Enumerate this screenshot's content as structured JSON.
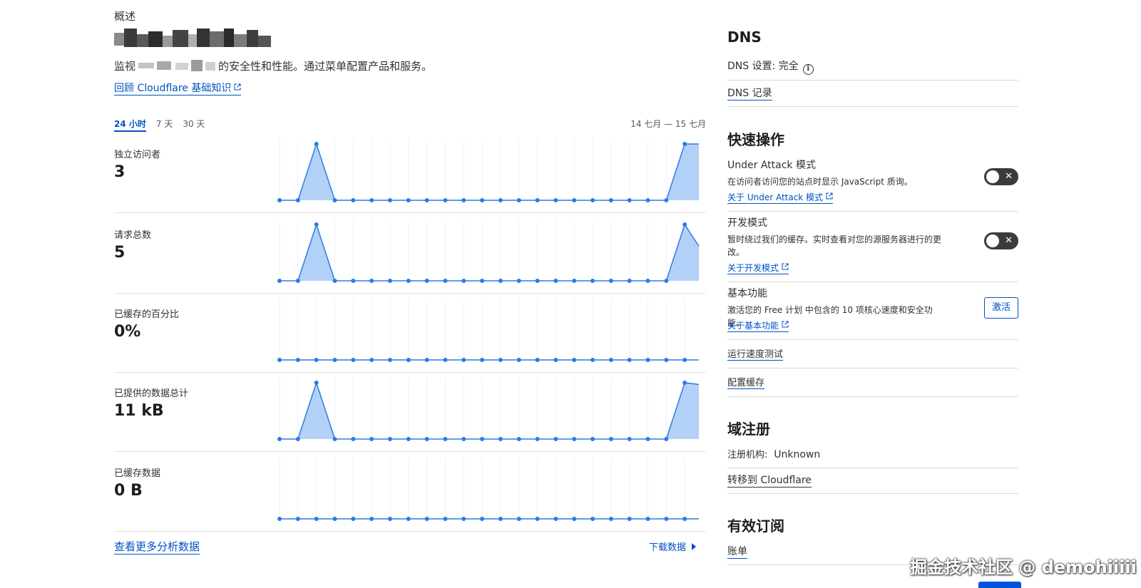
{
  "overview": {
    "section_label": "概述",
    "description_prefix": "监视",
    "description_suffix": "的安全性和性能。通过菜单配置产品和服务。",
    "review_link": "回顾 Cloudflare 基础知识"
  },
  "time_tabs": [
    {
      "label": "24 小时",
      "active": true
    },
    {
      "label": "7 天",
      "active": false
    },
    {
      "label": "30 天",
      "active": false
    }
  ],
  "date_range": "14 七月 — 15 七月",
  "metrics": [
    {
      "label": "独立访问者",
      "value": "3"
    },
    {
      "label": "请求总数",
      "value": "5"
    },
    {
      "label": "已缓存的百分比",
      "value": "0%"
    },
    {
      "label": "已提供的数据总计",
      "value": "11 kB"
    },
    {
      "label": "已缓存数据",
      "value": "0 B"
    }
  ],
  "chart_data": [
    {
      "type": "area",
      "title": "独立访问者",
      "ylim": [
        0,
        1
      ],
      "values": [
        0,
        0,
        1,
        0,
        0,
        0,
        0,
        0,
        0,
        0,
        0,
        0,
        0,
        0,
        0,
        0,
        0,
        0,
        0,
        0,
        0,
        0,
        1,
        1
      ]
    },
    {
      "type": "area",
      "title": "请求总数",
      "ylim": [
        0,
        1
      ],
      "values": [
        0,
        0,
        1,
        0,
        0,
        0,
        0,
        0,
        0,
        0,
        0,
        0,
        0,
        0,
        0,
        0,
        0,
        0,
        0,
        0,
        0,
        0,
        1,
        0.5
      ]
    },
    {
      "type": "area",
      "title": "已缓存的百分比",
      "ylim": [
        0,
        1
      ],
      "values": [
        0,
        0,
        0,
        0,
        0,
        0,
        0,
        0,
        0,
        0,
        0,
        0,
        0,
        0,
        0,
        0,
        0,
        0,
        0,
        0,
        0,
        0,
        0,
        0
      ]
    },
    {
      "type": "area",
      "title": "已提供的数据总计",
      "ylim": [
        0,
        1
      ],
      "values": [
        0,
        0,
        1,
        0,
        0,
        0,
        0,
        0,
        0,
        0,
        0,
        0,
        0,
        0,
        0,
        0,
        0,
        0,
        0,
        0,
        0,
        0,
        1,
        0.96
      ]
    },
    {
      "type": "area",
      "title": "已缓存数据",
      "ylim": [
        0,
        1
      ],
      "values": [
        0,
        0,
        0,
        0,
        0,
        0,
        0,
        0,
        0,
        0,
        0,
        0,
        0,
        0,
        0,
        0,
        0,
        0,
        0,
        0,
        0,
        0,
        0,
        0
      ]
    }
  ],
  "footer": {
    "more_link": "查看更多分析数据",
    "download": "下载数据"
  },
  "dns": {
    "title": "DNS",
    "settings": "DNS 设置: 完全",
    "records_link": "DNS 记录"
  },
  "quick_actions": {
    "title": "快速操作",
    "under_attack": {
      "title": "Under Attack 模式",
      "desc": "在访问者访问您的站点时显示 JavaScript 质询。",
      "link": "关于 Under Attack 模式"
    },
    "dev_mode": {
      "title": "开发模式",
      "desc": "暂时绕过我们的缓存。实时查看对您的源服务器进行的更改。",
      "link": "关于开发模式"
    },
    "basic": {
      "title": "基本功能",
      "desc": "激活您的 Free 计划 中包含的 10 项核心速度和安全功能。",
      "link": "关于基本功能",
      "button": "激活"
    },
    "speed_test": "运行速度测试",
    "config_cache": "配置缓存"
  },
  "domain": {
    "title": "域注册",
    "registrar_label": "注册机构:",
    "registrar_value": "Unknown",
    "transfer_link": "转移到 Cloudflare"
  },
  "subscriptions": {
    "title": "有效订阅",
    "billing_link": "账单"
  },
  "watermark": "掘金技术社区 @ demohiiiii",
  "colors": {
    "accent": "#0051c3",
    "chart_line": "#2c7be5",
    "chart_fill": "#b3d1f7",
    "toggle_bg": "#3b3b3b"
  }
}
